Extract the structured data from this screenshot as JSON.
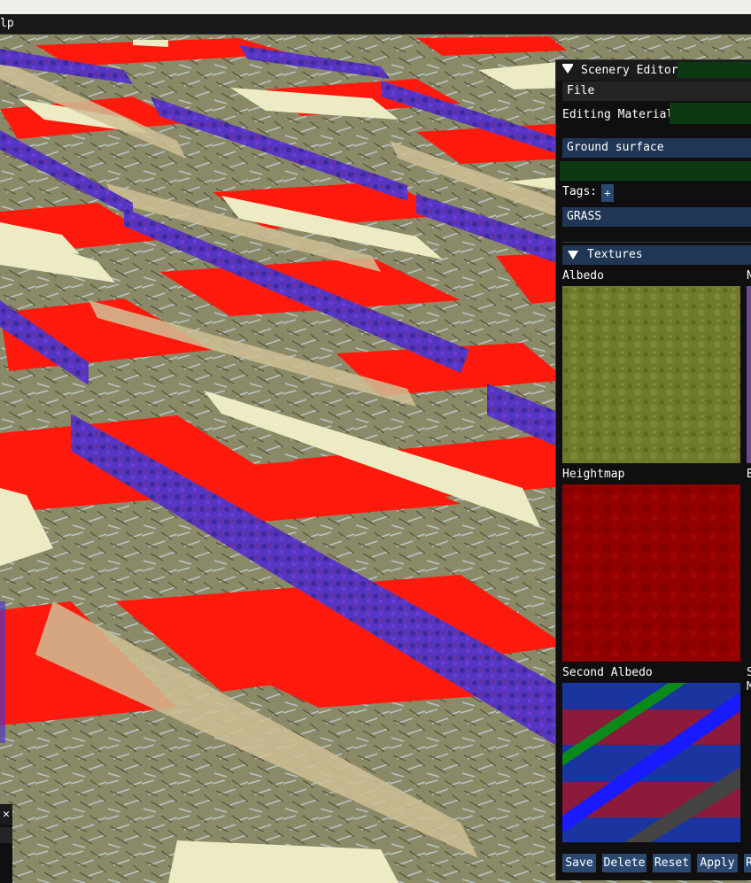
{
  "menu": {
    "help_fragment": "lp"
  },
  "editor": {
    "title": "Scenery Editor [",
    "file_menu": "File",
    "editing_material_label": "Editing Material",
    "material_name": "Ground surface",
    "tags_label": "Tags:",
    "add_tag_label": "+",
    "tags": [
      "GRASS"
    ],
    "textures_header": "Textures",
    "textures": {
      "albedo_label": "Albedo",
      "normal_label_fragment": "N",
      "heightmap_label": "Heightmap",
      "second_column_label_fragment": "B",
      "second_albedo_label": "Second Albedo",
      "fourth_row_fragment_1": "S",
      "fourth_row_fragment_2": "M"
    },
    "buttons": {
      "save": "Save",
      "delete": "Delete",
      "reset": "Reset",
      "apply": "Apply",
      "fifth_fragment": "R"
    }
  },
  "colors": {
    "accent_blue": "#2b4870",
    "field_blue": "#1f3655",
    "field_green": "#0b3a12",
    "panel_bg": "#0f0f10",
    "floor_red": "#ff1a0d",
    "floor_purple": "#5a2fc0",
    "floor_cream": "#ece8c0",
    "ground_tan": "#8a8a66"
  },
  "icons": [
    "collapse-triangle-icon",
    "plus-icon",
    "close-icon",
    "tree-node-open-icon"
  ]
}
